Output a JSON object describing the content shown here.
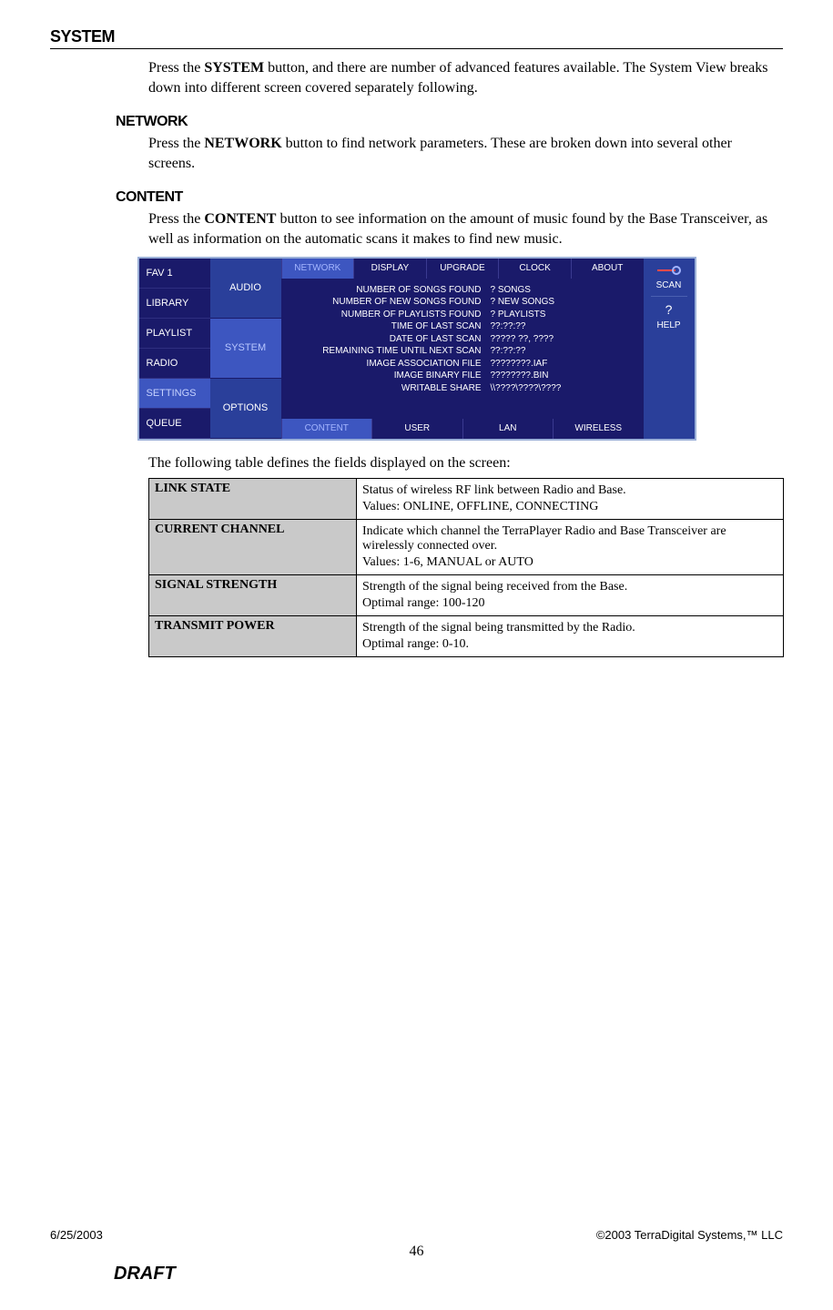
{
  "headings": {
    "main": "SYSTEM",
    "network": "NETWORK",
    "content": "CONTENT"
  },
  "paragraphs": {
    "system_p1_a": "Press the ",
    "system_p1_bold": "SYSTEM",
    "system_p1_b": " button, and there are number of advanced features available.  The System View breaks down into different screen covered separately following.",
    "network_p1_a": "Press the ",
    "network_p1_bold": "NETWORK",
    "network_p1_b": " button to find network parameters.  These are broken down into several other screens.",
    "content_p1_a": "Press the ",
    "content_p1_bold": "CONTENT",
    "content_p1_b": " button to see information on the amount of music found by the Base Transceiver, as well as information on the automatic scans it makes to find new music.",
    "table_intro": "The following table defines the fields displayed on the screen:"
  },
  "ui": {
    "left": [
      "FAV 1",
      "LIBRARY",
      "PLAYLIST",
      "RADIO",
      "SETTINGS",
      "QUEUE"
    ],
    "mid": [
      "AUDIO",
      "SYSTEM",
      "OPTIONS"
    ],
    "top_tabs": [
      "NETWORK",
      "DISPLAY",
      "UPGRADE",
      "CLOCK",
      "ABOUT"
    ],
    "bottom_tabs": [
      "CONTENT",
      "USER",
      "LAN",
      "WIRELESS"
    ],
    "right_scan": "SCAN",
    "right_q": "?",
    "right_help": "HELP",
    "rows": [
      {
        "lbl": "NUMBER OF SONGS FOUND",
        "val": "? SONGS"
      },
      {
        "lbl": "NUMBER OF NEW SONGS FOUND",
        "val": "? NEW SONGS"
      },
      {
        "lbl": "NUMBER OF PLAYLISTS FOUND",
        "val": "? PLAYLISTS"
      },
      {
        "lbl": "TIME OF LAST SCAN",
        "val": "??:??:??"
      },
      {
        "lbl": "DATE OF LAST SCAN",
        "val": "????? ??, ????"
      },
      {
        "lbl": "REMAINING TIME UNTIL NEXT SCAN",
        "val": "??:??:??"
      },
      {
        "lbl": "IMAGE ASSOCIATION FILE",
        "val": "????????.IAF"
      },
      {
        "lbl": "IMAGE BINARY FILE",
        "val": "????????.BIN"
      },
      {
        "lbl": "WRITABLE SHARE",
        "val": "\\\\????\\????\\????"
      }
    ]
  },
  "table": [
    {
      "key": "LINK STATE",
      "lines": [
        "Status of wireless RF link between Radio and Base.",
        "Values: ONLINE, OFFLINE, CONNECTING"
      ]
    },
    {
      "key": "CURRENT CHANNEL",
      "lines": [
        "Indicate which channel the TerraPlayer Radio and Base Transceiver are wirelessly connected over.",
        "Values: 1-6, MANUAL or AUTO"
      ]
    },
    {
      "key": "SIGNAL STRENGTH",
      "lines": [
        "Strength of the signal being received from the Base.",
        "Optimal range: 100-120"
      ]
    },
    {
      "key": "TRANSMIT POWER",
      "lines": [
        "Strength of the signal being transmitted by the Radio.",
        "Optimal range: 0-10."
      ]
    }
  ],
  "footer": {
    "date": "6/25/2003",
    "copyright": "©2003 TerraDigital Systems,™ LLC",
    "page": "46",
    "draft": "DRAFT"
  }
}
